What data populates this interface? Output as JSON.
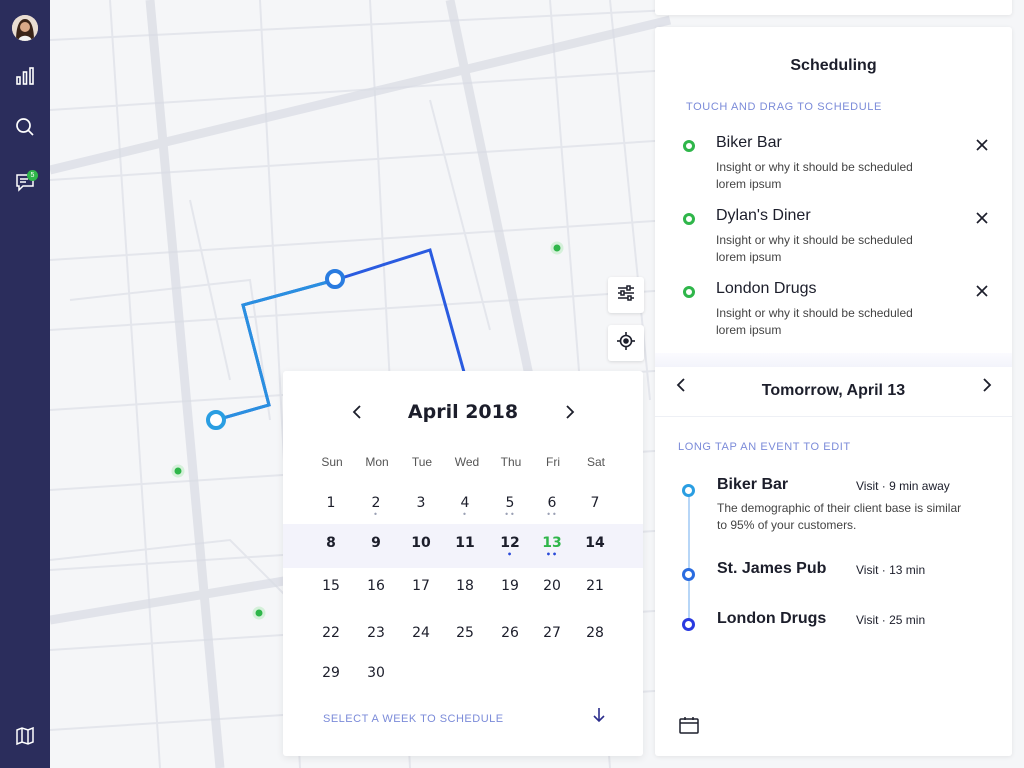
{
  "sidebar": {
    "items": [
      {
        "icon": "avatar"
      },
      {
        "icon": "bar-chart-icon"
      },
      {
        "icon": "search-icon"
      },
      {
        "icon": "chat-icon",
        "badge": "5"
      },
      {
        "icon": "map-icon"
      }
    ]
  },
  "map": {
    "controls": [
      {
        "icon": "filter-icon"
      },
      {
        "icon": "locate-icon"
      }
    ],
    "route_color": "#2a5be0",
    "marker_color": "#2fb64a"
  },
  "calendar": {
    "title": "April 2018",
    "weekdays": [
      "Sun",
      "Mon",
      "Tue",
      "Wed",
      "Thu",
      "Fri",
      "Sat"
    ],
    "weeks": [
      [
        "1",
        "2",
        "3",
        "4",
        "5",
        "6",
        "7"
      ],
      [
        "8",
        "9",
        "10",
        "11",
        "12",
        "13",
        "14"
      ],
      [
        "15",
        "16",
        "17",
        "18",
        "19",
        "20",
        "21"
      ],
      [
        "22",
        "23",
        "24",
        "25",
        "26",
        "27",
        "28"
      ],
      [
        "29",
        "30"
      ]
    ],
    "selected_week_index": 1,
    "highlighted_day": "13",
    "highlight_color": "#2fb64a",
    "footer": "SELECT A WEEK TO SCHEDULE"
  },
  "scheduling": {
    "title": "Scheduling",
    "caption": "TOUCH AND DRAG TO SCHEDULE",
    "items": [
      {
        "name": "Biker Bar",
        "desc": "Insight or why it should be scheduled lorem ipsum"
      },
      {
        "name": "Dylan's Diner",
        "desc": "Insight or why it should be scheduled lorem ipsum"
      },
      {
        "name": "London Drugs",
        "desc": "Insight or why it should be scheduled lorem ipsum"
      }
    ],
    "day_title": "Tomorrow, April 13",
    "edit_caption": "LONG TAP AN EVENT TO EDIT",
    "events": [
      {
        "name": "Biker Bar",
        "meta": "Visit  ·   9 min away",
        "desc": "The demographic of their client base is similar to 95% of your customers."
      },
      {
        "name": "St. James Pub",
        "meta": "Visit  ·   13 min",
        "desc": ""
      },
      {
        "name": "London Drugs",
        "meta": "Visit  ·   25 min",
        "desc": ""
      }
    ]
  }
}
